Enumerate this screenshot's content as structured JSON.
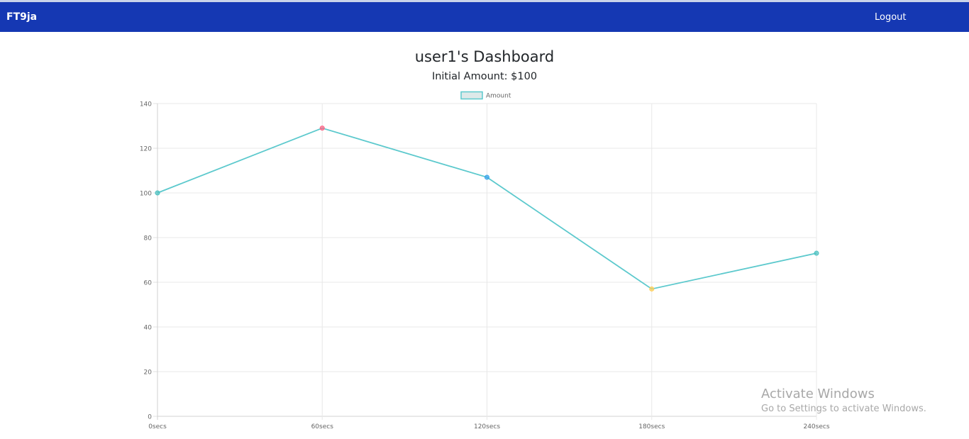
{
  "navbar": {
    "brand": "FT9ja",
    "logout_label": "Logout",
    "bg_color": "#1538b3"
  },
  "dashboard": {
    "title": "user1's Dashboard",
    "subtitle": "Initial Amount: $100"
  },
  "chart_data": {
    "type": "line",
    "categories": [
      "0secs",
      "60secs",
      "120secs",
      "180secs",
      "240secs"
    ],
    "series": [
      {
        "name": "Amount",
        "values": [
          100,
          129,
          107,
          57,
          73
        ],
        "line_color": "#5cc9cd",
        "point_colors": [
          "#4bc0c0",
          "#ff6384",
          "#36a2eb",
          "#ffce56",
          "#4bc0c0"
        ]
      }
    ],
    "ylim": [
      0,
      140
    ],
    "yticks": [
      0,
      20,
      40,
      60,
      80,
      100,
      120,
      140
    ],
    "grid": true,
    "legend": "top-center",
    "title": "",
    "xlabel": "",
    "ylabel": ""
  },
  "watermark": {
    "title": "Activate Windows",
    "subtitle": "Go to Settings to activate Windows."
  }
}
